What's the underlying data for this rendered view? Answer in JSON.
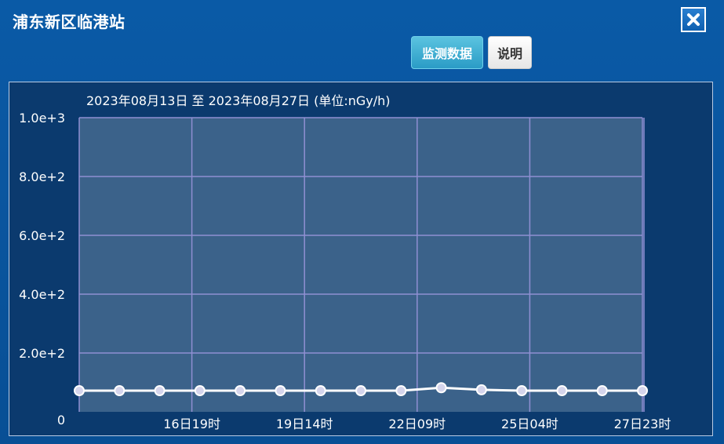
{
  "window": {
    "title": "浦东新区临港站",
    "close_icon": "close-icon"
  },
  "toolbar": {
    "data_label": "监测数据",
    "help_label": "说明"
  },
  "colors": {
    "background": "#0a56a0",
    "plot_area": "#3b628a",
    "grid": "#8f8fd2",
    "line": "#ffffff",
    "marker_fill": "#d5d5ec",
    "active_button": "#3aaed2"
  },
  "chart_data": {
    "type": "line",
    "subtitle": "2023年08月13日 至 2023年08月27日 (单位:nGy/h)",
    "title": "",
    "xlabel": "",
    "ylabel": "",
    "ylim": [
      0,
      1000
    ],
    "y_ticks": [
      {
        "value": 0,
        "label": "0"
      },
      {
        "value": 200,
        "label": "2.0e+2"
      },
      {
        "value": 400,
        "label": "4.0e+2"
      },
      {
        "value": 600,
        "label": "6.0e+2"
      },
      {
        "value": 800,
        "label": "8.0e+2"
      },
      {
        "value": 1000,
        "label": "1.0e+3"
      }
    ],
    "x_ticks": [
      {
        "index": 2.8,
        "label": "16日19时"
      },
      {
        "index": 5.6,
        "label": "19日14时"
      },
      {
        "index": 8.4,
        "label": "22日09时"
      },
      {
        "index": 11.2,
        "label": "25日04时"
      },
      {
        "index": 14,
        "label": "27日23时"
      }
    ],
    "grid": true,
    "series": [
      {
        "values": [
          72,
          72,
          72,
          72,
          72,
          72,
          72,
          72,
          72,
          82,
          75,
          72,
          72,
          72,
          72
        ]
      }
    ]
  }
}
